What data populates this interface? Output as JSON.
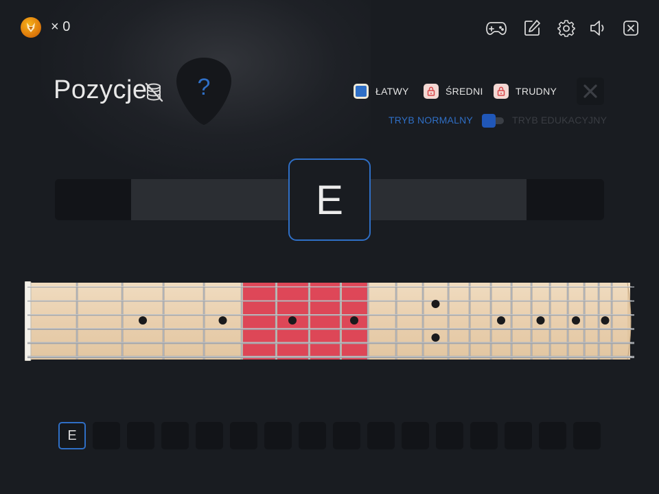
{
  "header": {
    "coin_count": "× 0",
    "icons": [
      "gamepad-icon",
      "edit-icon",
      "settings-icon",
      "volume-icon",
      "exit-icon"
    ]
  },
  "title": "Pozycje",
  "help_symbol": "?",
  "difficulty": [
    {
      "label": "ŁATWY",
      "state": "selected"
    },
    {
      "label": "ŚREDNI",
      "state": "locked"
    },
    {
      "label": "TRUDNY",
      "state": "locked"
    }
  ],
  "close_symbol": "✕",
  "mode": {
    "normal_label": "TRYB NORMALNY",
    "education_label": "TRYB EDUKACYJNY",
    "active": "normal"
  },
  "progress_fraction": 0.72,
  "current_note": "E",
  "fretboard": {
    "frets": 21,
    "strings": 6,
    "highlighted_frets": [
      6,
      7,
      8,
      9
    ],
    "single_dot_frets": [
      3,
      5,
      7,
      9,
      15,
      17,
      19,
      21
    ],
    "double_dot_frets": [
      12
    ]
  },
  "answer_slots": [
    "E",
    "",
    "",
    "",
    "",
    "",
    "",
    "",
    "",
    "",
    "",
    "",
    "",
    "",
    "",
    ""
  ],
  "colors": {
    "accent": "#2f6fc6",
    "highlight": "#dc3f52",
    "background": "#191c21",
    "wood": "#e9cfae"
  }
}
